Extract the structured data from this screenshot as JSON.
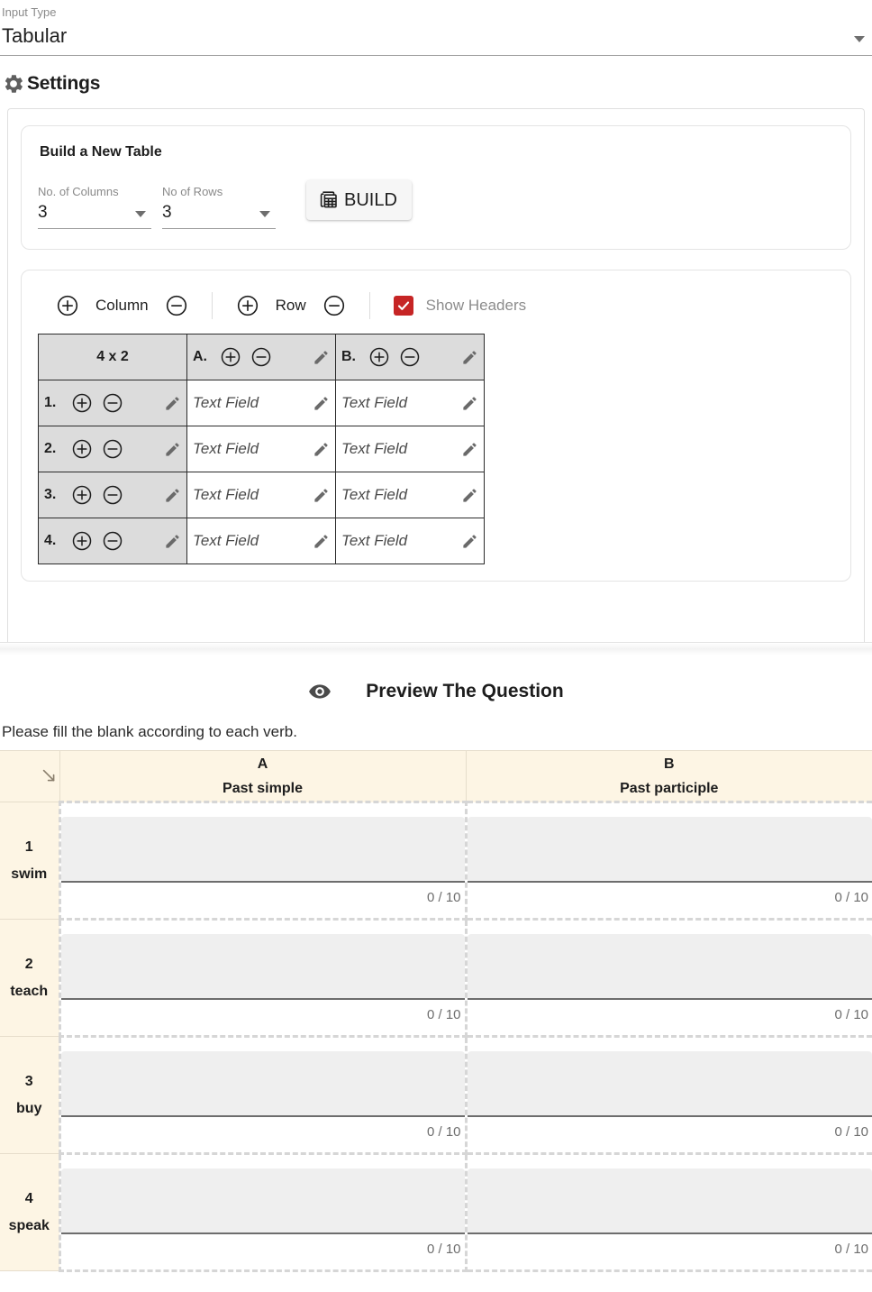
{
  "input_type": {
    "label": "Input Type",
    "value": "Tabular",
    "arrow_icon": "chevron-down-icon"
  },
  "settings": {
    "title": "Settings",
    "icon": "gear-icon"
  },
  "build_card": {
    "title": "Build a New Table",
    "columns_field": {
      "label": "No. of Columns",
      "value": "3"
    },
    "rows_field": {
      "label": "No of Rows",
      "value": "3"
    },
    "build_button": {
      "label": "BUILD",
      "icon": "table-grid-icon"
    }
  },
  "grid_controls": {
    "column_label": "Column",
    "row_label": "Row",
    "add_icon": "plus-circle-icon",
    "remove_icon": "minus-circle-icon",
    "show_headers_label": "Show Headers",
    "show_headers_checked": true,
    "checkbox_color": "#c62525"
  },
  "editor_table": {
    "size_label": "4 x 2",
    "edit_icon": "pencil-icon",
    "column_headers": [
      "A.",
      "B."
    ],
    "row_headers": [
      "1.",
      "2.",
      "3.",
      "4."
    ],
    "cell_placeholder": "Text Field",
    "rows": [
      [
        "Text Field",
        "Text Field"
      ],
      [
        "Text Field",
        "Text Field"
      ],
      [
        "Text Field",
        "Text Field"
      ],
      [
        "Text Field",
        "Text Field"
      ]
    ]
  },
  "preview": {
    "title": "Preview The Question",
    "icon": "eye-icon",
    "question": "Please fill the blank according to each verb.",
    "corner_icon": "arrow-down-right-icon",
    "columns": [
      {
        "letter": "A",
        "name": "Past simple"
      },
      {
        "letter": "B",
        "name": "Past participle"
      }
    ],
    "rows": [
      {
        "number": "1",
        "label": "swim",
        "cells": [
          {
            "value": "",
            "counter": "0 / 10"
          },
          {
            "value": "",
            "counter": "0 / 10"
          }
        ]
      },
      {
        "number": "2",
        "label": "teach",
        "cells": [
          {
            "value": "",
            "counter": "0 / 10"
          },
          {
            "value": "",
            "counter": "0 / 10"
          }
        ]
      },
      {
        "number": "3",
        "label": "buy",
        "cells": [
          {
            "value": "",
            "counter": "0 / 10"
          },
          {
            "value": "",
            "counter": "0 / 10"
          }
        ]
      },
      {
        "number": "4",
        "label": "speak",
        "cells": [
          {
            "value": "",
            "counter": "0 / 10"
          },
          {
            "value": "",
            "counter": "0 / 10"
          }
        ]
      }
    ]
  }
}
